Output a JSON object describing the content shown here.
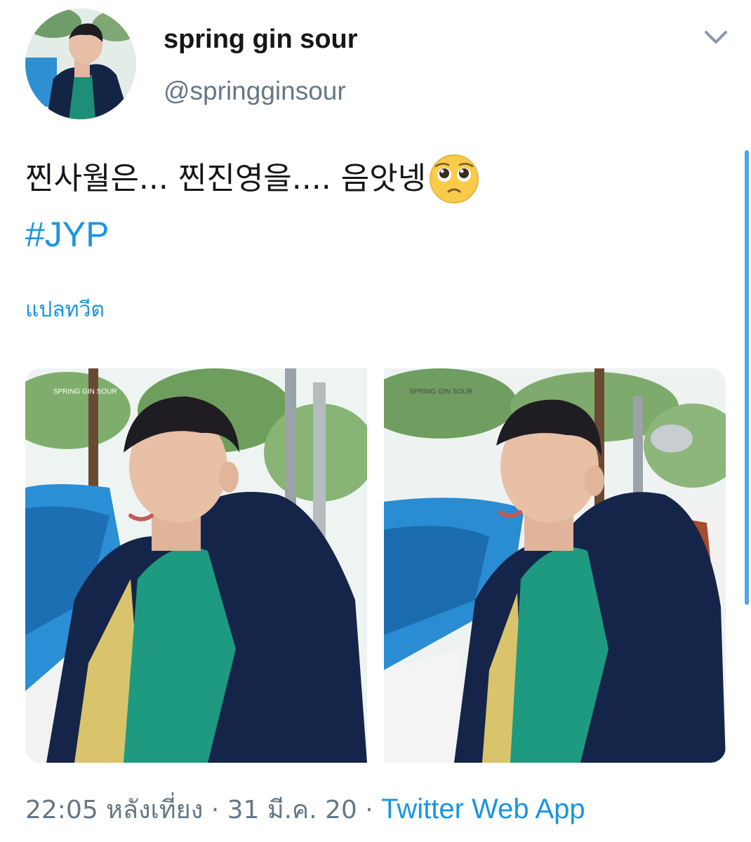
{
  "tweet": {
    "author": {
      "display_name": "spring gin sour",
      "handle": "@springginsour",
      "avatar": "avatar-photo"
    },
    "menu_icon": "chevron-down-icon",
    "text_line_1": "찐사월은... 찐진영을.... 음앗넹",
    "emoji": "pleading-face-emoji",
    "hashtag": "#JYP",
    "translate_label": "แปลทวีต",
    "timestamp": "22:05 หลังเที่ยง · 31 มี.ค. 20 · ",
    "source": "Twitter Web App",
    "photos": [
      {
        "watermark": "SPRING GIN SOUR"
      },
      {
        "watermark": "SPRING GIN SOUR"
      }
    ]
  },
  "colors": {
    "link": "#1b95e0",
    "text": "#14171a",
    "muted": "#657786"
  }
}
